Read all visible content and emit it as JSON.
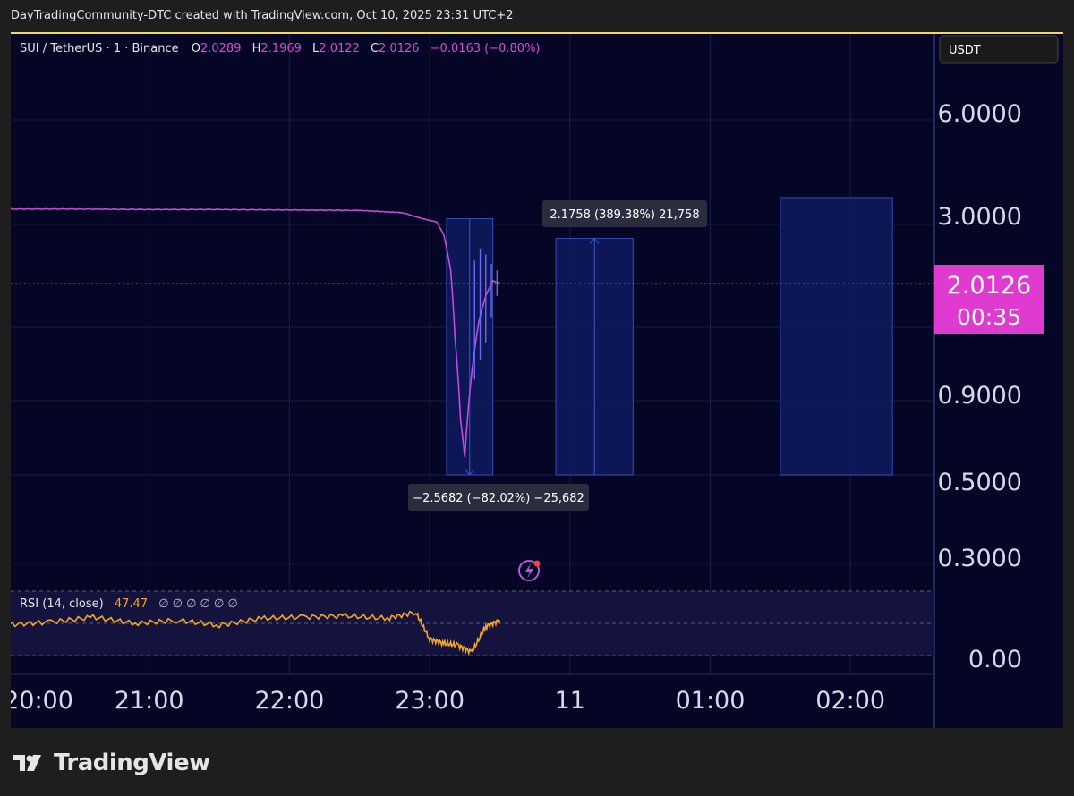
{
  "header": {
    "attribution": "DayTradingCommunity-DTC created with TradingView.com, Oct 10, 2025 23:31 UTC+2"
  },
  "legend": {
    "symbol": "SUI / TetherUS · 1 · Binance",
    "o_label": "O",
    "o_value": "2.0289",
    "h_label": "H",
    "h_value": "2.1969",
    "l_label": "L",
    "l_value": "2.0122",
    "c_label": "C",
    "c_value": "2.0126",
    "change": "−0.0163 (−0.80%)"
  },
  "currency_button": "USDT",
  "price_label": {
    "price": "2.0126",
    "countdown": "00:35"
  },
  "measure_up": "2.1758 (389.38%) 21,758",
  "measure_down": "−2.5682 (−82.02%) −25,682",
  "rsi_legend": {
    "name": "RSI (14, close)",
    "value": "47.47",
    "extras": "∅ ∅ ∅ ∅ ∅ ∅"
  },
  "footer": {
    "brand": "TradingView"
  },
  "colors": {
    "background": "#050526",
    "price_line": "#c44bd8",
    "price_tag": "#e03bd0",
    "rsi_line": "#f5a623",
    "measure_box": "#0e1a5c",
    "measure_border": "#3a56c8",
    "accent_top": "#f5d85a",
    "grid": "#1b1d4a"
  },
  "chart_data": {
    "type": "line",
    "title": "",
    "xlabel": "",
    "ylabel": "",
    "y_scale": "log",
    "x_tick_labels": [
      "20:00",
      "21:00",
      "22:00",
      "23:00",
      "11",
      "01:00",
      "02:00"
    ],
    "y_tick_labels": [
      "6.0000",
      "3.0000",
      "0.9000",
      "0.5000",
      "0.3000",
      "0.00"
    ],
    "y_ticks": [
      6.0,
      3.0,
      0.9,
      0.5,
      0.3
    ],
    "price_series": {
      "x_hours": [
        20.0,
        20.5,
        21.0,
        21.5,
        22.0,
        22.5,
        22.8,
        22.95,
        23.05,
        23.1,
        23.15,
        23.18,
        23.22,
        23.25,
        23.3,
        23.35,
        23.4,
        23.45,
        23.5
      ],
      "y": [
        3.33,
        3.33,
        3.32,
        3.32,
        3.31,
        3.3,
        3.25,
        3.12,
        3.05,
        2.8,
        2.2,
        1.4,
        0.8,
        0.62,
        1.1,
        1.55,
        1.85,
        2.05,
        2.01
      ]
    },
    "rsi": {
      "range": [
        0,
        100
      ],
      "bands": [
        30,
        70
      ],
      "x_hours": [
        20.0,
        20.3,
        20.6,
        20.9,
        21.2,
        21.5,
        21.8,
        22.1,
        22.4,
        22.7,
        22.9,
        23.0,
        23.1,
        23.2,
        23.3,
        23.4,
        23.5
      ],
      "y": [
        48,
        52,
        60,
        50,
        55,
        47,
        58,
        60,
        62,
        58,
        68,
        25,
        18,
        15,
        4,
        45,
        55
      ]
    },
    "measures": [
      {
        "x_start": 23.12,
        "x_end": 23.45,
        "y_start": 3.12,
        "y_end": 0.55,
        "label": "measure_down"
      },
      {
        "x_start": 23.9,
        "x_end": 24.45,
        "y_start": 0.55,
        "y_end": 2.73,
        "label": "measure_up"
      },
      {
        "x_start": 25.5,
        "x_end": 26.3,
        "y_start": 0.55,
        "y_end": 3.6
      }
    ],
    "last_price": 2.0126
  }
}
